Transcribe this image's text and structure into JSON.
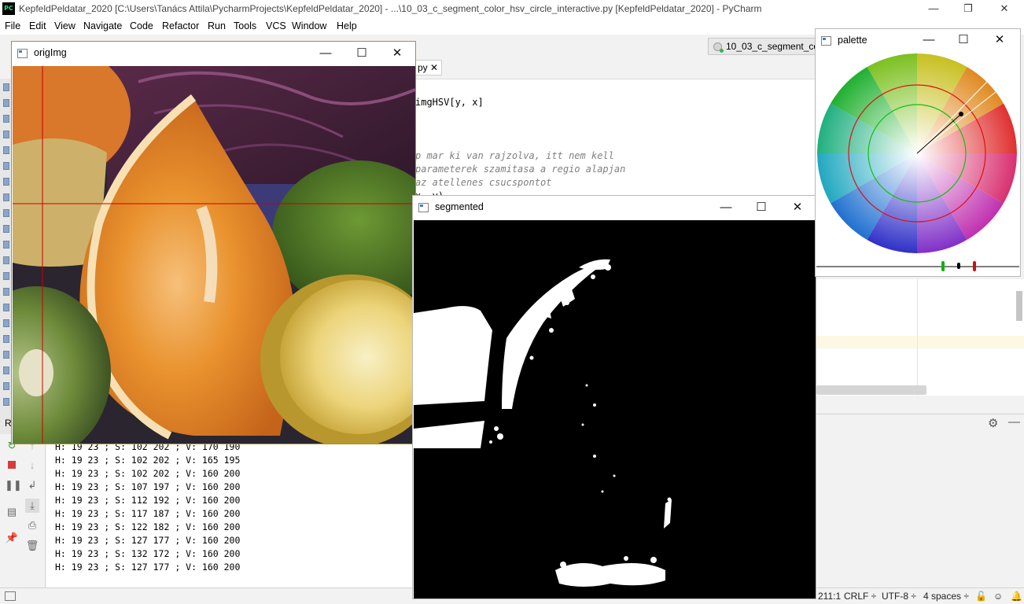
{
  "ide": {
    "title": "KepfeldPeldatar_2020 [C:\\Users\\Tanács Attila\\PycharmProjects\\KepfeldPeldatar_2020] - ...\\10_03_c_segment_color_hsv_circle_interactive.py [KepfeldPeldatar_2020] - PyCharm",
    "logo_text": "PC",
    "window_controls": {
      "minimize": "—",
      "restore": "❐",
      "close": "✕"
    },
    "menu": [
      "File",
      "Edit",
      "View",
      "Navigate",
      "Code",
      "Refactor",
      "Run",
      "Tools",
      "VCS",
      "Window",
      "Help"
    ],
    "editor_tab": "10_03_c_segment_color_hsv_circle_interactive.py",
    "inner_tab": "py ✕",
    "code_lines": [
      {
        "text": "imgHSV[y, x]",
        "comment": false
      },
      {
        "text": "p mar ki van rajzolva, itt nem kell",
        "comment": true
      },
      {
        "text": "parameterek szamitasa a regio alapjan",
        "comment": true
      },
      {
        "text": "az atellenes csucspontot",
        "comment": true
      },
      {
        "text": "x, y)",
        "comment": false
      }
    ],
    "run_label": "R",
    "console_lines": [
      "H: 19 23 ; S: 102 202 ; V: 170 190",
      "H: 19 23 ; S: 102 202 ; V: 165 195",
      "H: 19 23 ; S: 102 202 ; V: 160 200",
      "H: 19 23 ; S: 107 197 ; V: 160 200",
      "H: 19 23 ; S: 112 192 ; V: 160 200",
      "H: 19 23 ; S: 117 187 ; V: 160 200",
      "H: 19 23 ; S: 122 182 ; V: 160 200",
      "H: 19 23 ; S: 127 177 ; V: 160 200",
      "H: 19 23 ; S: 132 172 ; V: 160 200",
      "H: 19 23 ; S: 127 177 ; V: 160 200"
    ],
    "status": {
      "position": "211:1",
      "line_sep": "CRLF ÷",
      "encoding": "UTF-8 ÷",
      "indent": "4 spaces ÷"
    }
  },
  "windows": {
    "orig": {
      "title": "origImg"
    },
    "segmented": {
      "title": "segmented"
    },
    "palette": {
      "title": "palette"
    }
  },
  "cv_controls": {
    "minimize": "—",
    "maximize": "☐",
    "close": "✕"
  },
  "colors": {
    "accent_crosshair": "#cc0000",
    "palette_outer_circle": "#e01010",
    "palette_inner_circle": "#10c010",
    "orange": "#e8892a",
    "lime": "#4f7a24"
  }
}
